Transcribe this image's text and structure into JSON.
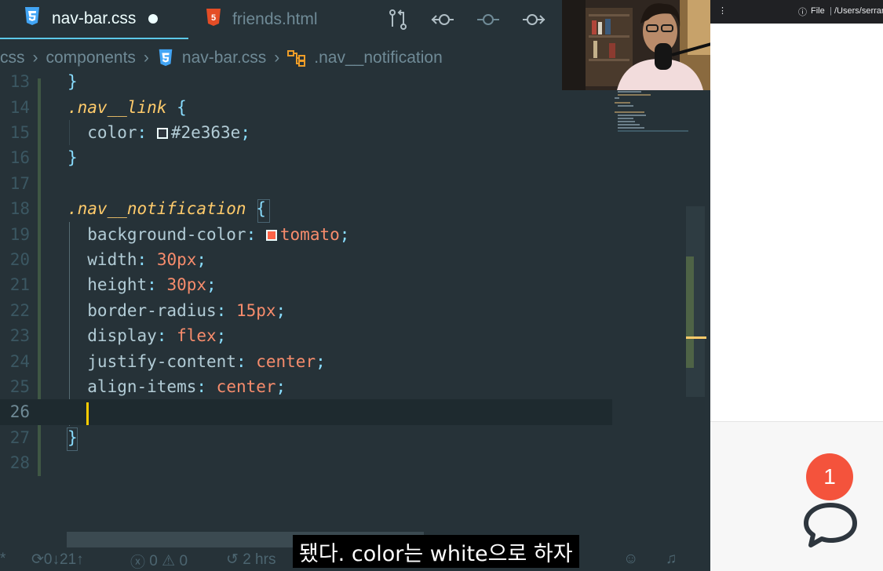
{
  "tabs": [
    {
      "label": "nav-bar.css",
      "icon": "css3-file-icon",
      "active": true,
      "dirty": true
    },
    {
      "label": "friends.html",
      "icon": "html5-file-icon",
      "active": false
    }
  ],
  "breadcrumb": {
    "folder1": "css",
    "folder2": "components",
    "file": "nav-bar.css",
    "symbol": ".nav__notification"
  },
  "code": {
    "lines": [
      {
        "n": "13",
        "tokens": [
          {
            "t": "}",
            "c": "p"
          }
        ]
      },
      {
        "n": "14",
        "tokens": [
          {
            "t": ".nav__link",
            "c": "sel"
          },
          {
            "t": " {",
            "c": "p"
          }
        ]
      },
      {
        "n": "15",
        "tokens": [
          {
            "t": "  color",
            "c": "prop"
          },
          {
            "t": ":",
            "c": "p"
          },
          {
            "t": " ",
            "c": "p"
          },
          {
            "swatch": "#2e363e",
            "border": "#eeffff"
          },
          {
            "t": "#2e363e",
            "c": "val2"
          },
          {
            "t": ";",
            "c": "p"
          }
        ]
      },
      {
        "n": "16",
        "tokens": [
          {
            "t": "}",
            "c": "p"
          }
        ]
      },
      {
        "n": "17",
        "tokens": []
      },
      {
        "n": "18",
        "tokens": [
          {
            "t": ".nav__notification",
            "c": "sel"
          },
          {
            "t": " {",
            "c": "p"
          }
        ]
      },
      {
        "n": "19",
        "tokens": [
          {
            "t": "  background-color",
            "c": "prop"
          },
          {
            "t": ":",
            "c": "p"
          },
          {
            "t": " ",
            "c": "p"
          },
          {
            "swatch": "#ff6347",
            "border": "#eeffff"
          },
          {
            "t": "tomato",
            "c": "val"
          },
          {
            "t": ";",
            "c": "p"
          }
        ]
      },
      {
        "n": "20",
        "tokens": [
          {
            "t": "  width",
            "c": "prop"
          },
          {
            "t": ":",
            "c": "p"
          },
          {
            "t": " 30px",
            "c": "val"
          },
          {
            "t": ";",
            "c": "p"
          }
        ]
      },
      {
        "n": "21",
        "tokens": [
          {
            "t": "  height",
            "c": "prop"
          },
          {
            "t": ":",
            "c": "p"
          },
          {
            "t": " 30px",
            "c": "val"
          },
          {
            "t": ";",
            "c": "p"
          }
        ]
      },
      {
        "n": "22",
        "tokens": [
          {
            "t": "  border-radius",
            "c": "prop"
          },
          {
            "t": ":",
            "c": "p"
          },
          {
            "t": " 15px",
            "c": "val"
          },
          {
            "t": ";",
            "c": "p"
          }
        ]
      },
      {
        "n": "23",
        "tokens": [
          {
            "t": "  display",
            "c": "prop"
          },
          {
            "t": ":",
            "c": "p"
          },
          {
            "t": " flex",
            "c": "val"
          },
          {
            "t": ";",
            "c": "p"
          }
        ]
      },
      {
        "n": "24",
        "tokens": [
          {
            "t": "  justify-content",
            "c": "prop"
          },
          {
            "t": ":",
            "c": "p"
          },
          {
            "t": " center",
            "c": "val"
          },
          {
            "t": ";",
            "c": "p"
          }
        ]
      },
      {
        "n": "25",
        "tokens": [
          {
            "t": "  align-items",
            "c": "prop"
          },
          {
            "t": ":",
            "c": "p"
          },
          {
            "t": " center",
            "c": "val"
          },
          {
            "t": ";",
            "c": "p"
          }
        ]
      },
      {
        "n": "26",
        "tokens": [],
        "current": true
      },
      {
        "n": "27",
        "tokens": [
          {
            "t": "}",
            "c": "p"
          }
        ]
      },
      {
        "n": "28",
        "tokens": []
      }
    ]
  },
  "statusbar": {
    "sync_count_down": "0",
    "sync_count_up": "21",
    "errors": "0",
    "warnings": "0",
    "time": "2 hrs"
  },
  "browser": {
    "file_label": "File",
    "path": "/Users/serran",
    "badge_count": "1"
  },
  "subtitle": "됐다. color는 white으로 하자",
  "colors": {
    "editor_bg": "#263238",
    "accent": "#5cc8e8",
    "selector": "#ffcb6b",
    "value": "#f78c6c",
    "badge": "#f4533c"
  }
}
